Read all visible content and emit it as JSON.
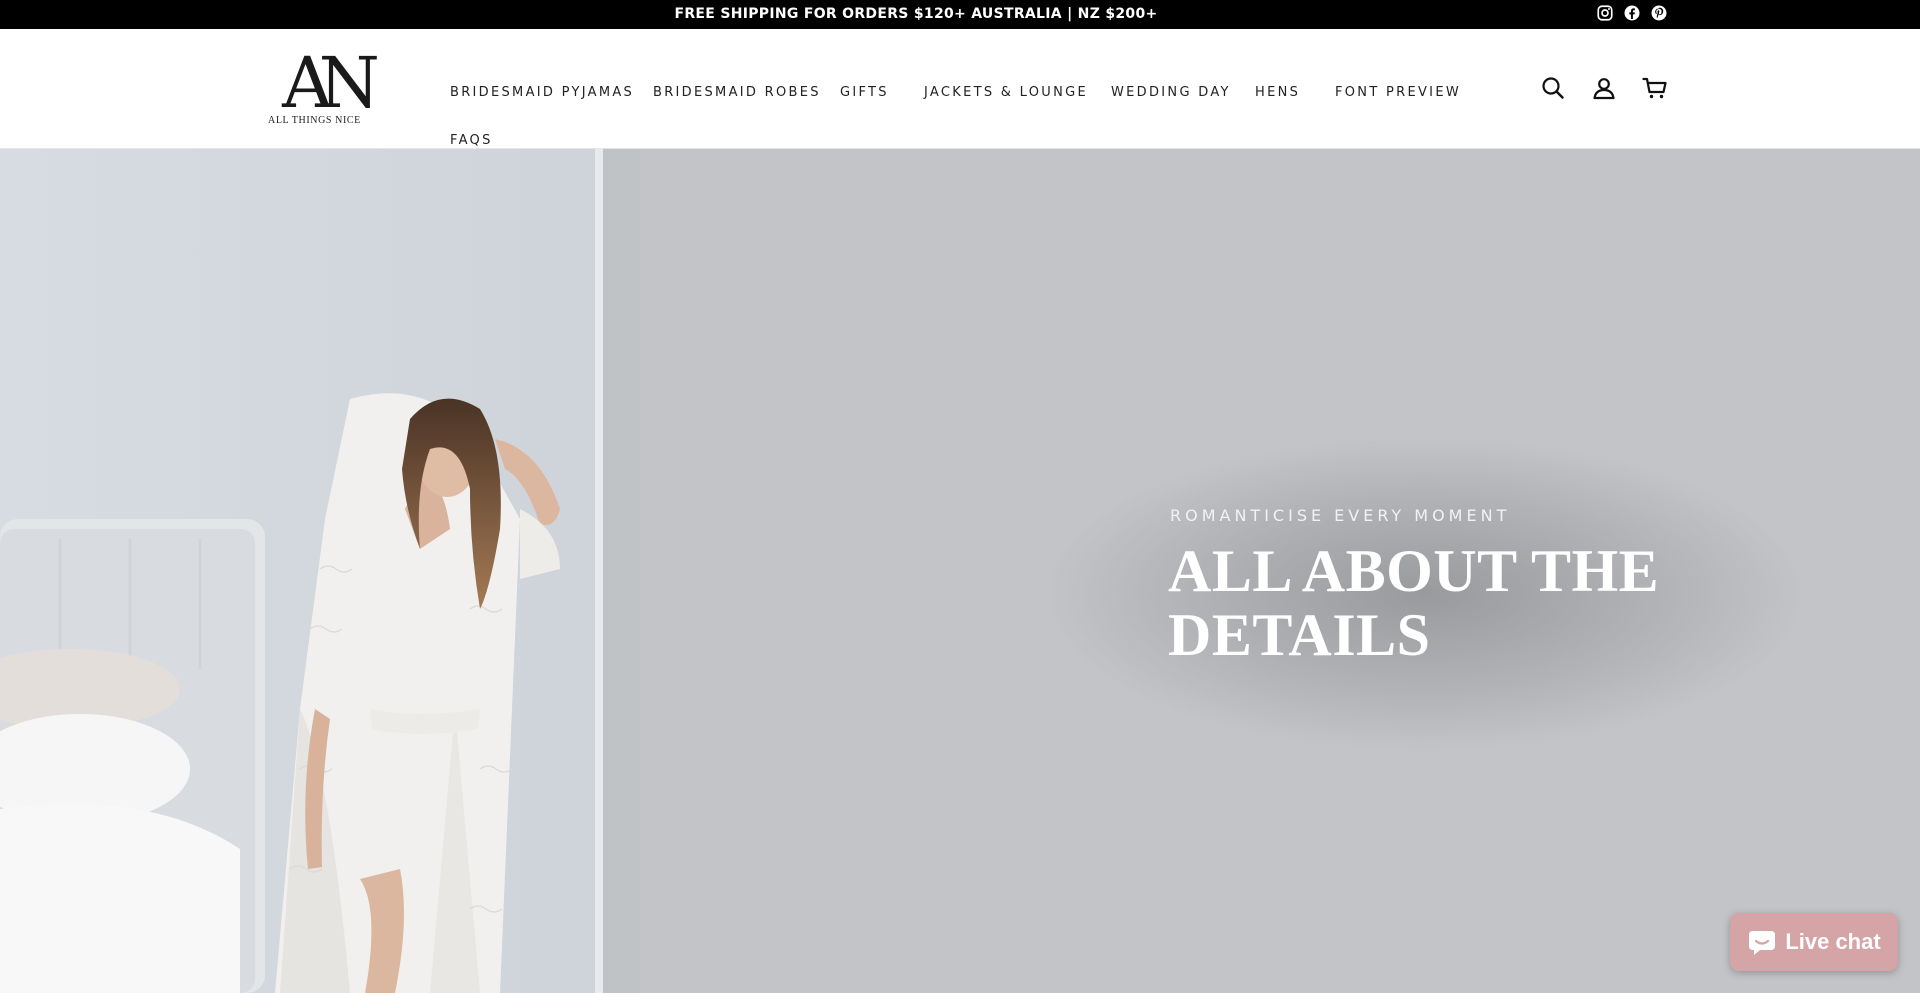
{
  "announcement": {
    "text": "FREE SHIPPING FOR ORDERS $120+ AUSTRALIA | NZ $200+",
    "socials": [
      "instagram-icon",
      "facebook-icon",
      "pinterest-icon"
    ]
  },
  "brand": {
    "mark": "AN",
    "name": "ALL THINGS NICE"
  },
  "nav": {
    "items": [
      {
        "label": "BRIDESMAID PYJAMAS"
      },
      {
        "label": "BRIDESMAID ROBES"
      },
      {
        "label": "GIFTS"
      },
      {
        "label": "JACKETS & LOUNGE"
      },
      {
        "label": "WEDDING DAY"
      },
      {
        "label": "HENS"
      },
      {
        "label": "FONT PREVIEW"
      },
      {
        "label": "FAQS"
      }
    ]
  },
  "header_icons": [
    "search-icon",
    "account-icon",
    "cart-icon"
  ],
  "hero": {
    "subheading": "ROMANTICISE EVERY MOMENT",
    "title": "ALL ABOUT THE DETAILS"
  },
  "chat": {
    "label": "Live chat"
  },
  "colors": {
    "announcement_bg": "#000000",
    "hero_bg": "#c2c4c7",
    "chat_bg": "#d4a4a6",
    "text_dark": "#222222"
  }
}
